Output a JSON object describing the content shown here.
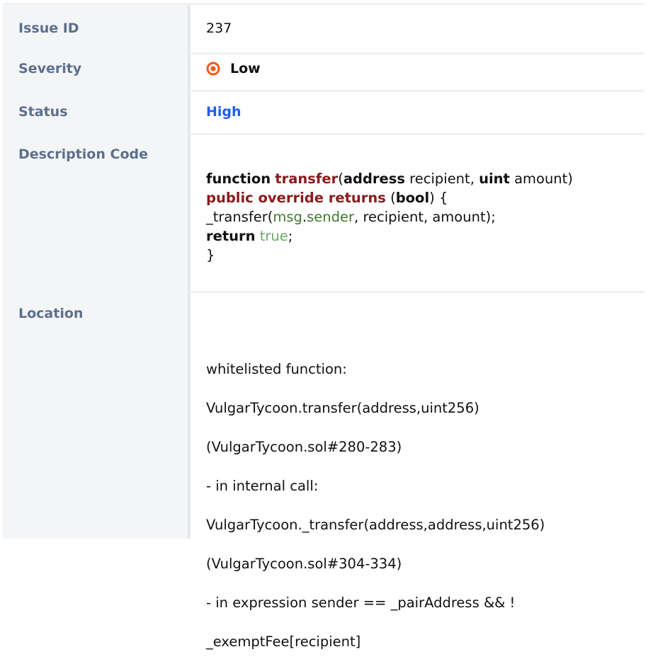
{
  "rows": {
    "issue_id": {
      "label": "Issue ID",
      "value": "237"
    },
    "severity": {
      "label": "Severity",
      "value": "Low",
      "icon": "severity-target-icon",
      "icon_color": "#f25a14"
    },
    "status": {
      "label": "Status",
      "value": "High",
      "value_color": "#1e5ee8"
    },
    "description": {
      "label": "Description Code",
      "code": {
        "l1_kw1": "function",
        "l1_fn": "transfer",
        "l1_p1": "(",
        "l1_kw2": "address",
        "l1_t1": " recipient, ",
        "l1_kw3": "uint",
        "l1_t2": " amount)",
        "l2_mod": "public override returns",
        "l2_t1": " (",
        "l2_kw": "bool",
        "l2_t2": ") {",
        "l3_t1": "_transfer(",
        "l3_gr1": "msg",
        "l3_t2": ".",
        "l3_gr2": "sender",
        "l3_t3": ", recipient, amount);",
        "l4_kw": "return",
        "l4_sp": " ",
        "l4_lit": "true",
        "l4_t": ";",
        "l5": "}"
      }
    },
    "location": {
      "label": "Location",
      "lines": [
        "whitelisted function:",
        "VulgarTycoon.transfer(address,uint256)",
        "(VulgarTycoon.sol#280-283)",
        "- in internal call:",
        "VulgarTycoon._transfer(address,address,uint256)",
        "(VulgarTycoon.sol#304-334)",
        "- in expression sender == _pairAddress && !",
        "_exemptFee[recipient]"
      ]
    }
  }
}
